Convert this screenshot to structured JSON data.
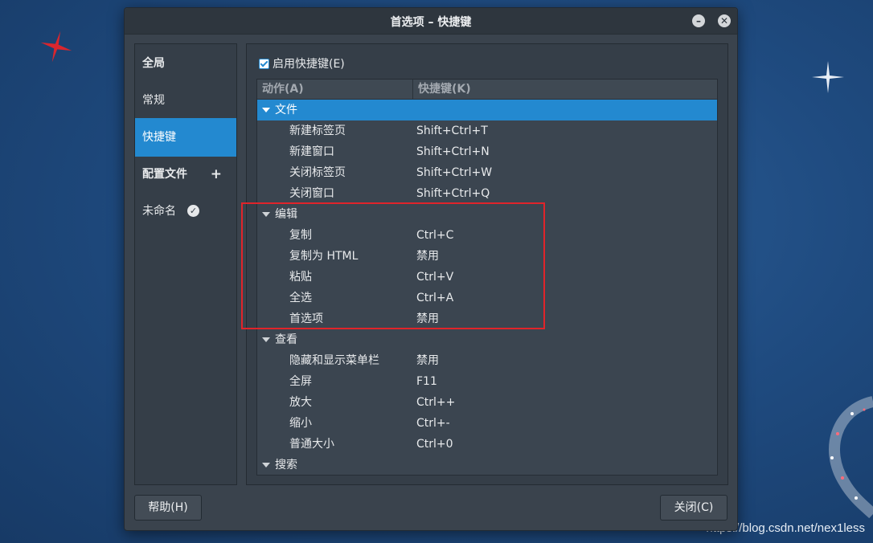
{
  "window": {
    "title": "首选项 – 快捷键",
    "minimize_icon": "minimize-icon",
    "close_icon": "close-icon"
  },
  "sidebar": {
    "items": [
      {
        "label": "全局",
        "type": "header"
      },
      {
        "label": "常规",
        "type": "item"
      },
      {
        "label": "快捷键",
        "type": "item",
        "active": true
      },
      {
        "label": "配置文件",
        "type": "header",
        "icon": "plus-icon",
        "icon_glyph": "+"
      },
      {
        "label": "未命名",
        "type": "item",
        "icon": "check-circle-icon",
        "icon_glyph": "✓"
      }
    ]
  },
  "content": {
    "enable_label": "启用快捷键(E)",
    "enable_checked": true,
    "columns": {
      "action": "动作(A)",
      "shortcut": "快捷键(K)"
    },
    "categories": [
      {
        "label": "文件",
        "selected": true,
        "items": [
          {
            "action": "新建标签页",
            "key": "Shift+Ctrl+T"
          },
          {
            "action": "新建窗口",
            "key": "Shift+Ctrl+N"
          },
          {
            "action": "关闭标签页",
            "key": "Shift+Ctrl+W"
          },
          {
            "action": "关闭窗口",
            "key": "Shift+Ctrl+Q"
          }
        ]
      },
      {
        "label": "编辑",
        "items": [
          {
            "action": "复制",
            "key": "Ctrl+C"
          },
          {
            "action": "复制为 HTML",
            "key": "禁用"
          },
          {
            "action": "粘贴",
            "key": "Ctrl+V"
          },
          {
            "action": "全选",
            "key": "Ctrl+A"
          },
          {
            "action": "首选项",
            "key": "禁用"
          }
        ]
      },
      {
        "label": "查看",
        "items": [
          {
            "action": "隐藏和显示菜单栏",
            "key": "禁用"
          },
          {
            "action": "全屏",
            "key": "F11"
          },
          {
            "action": "放大",
            "key": "Ctrl++"
          },
          {
            "action": "缩小",
            "key": "Ctrl+-"
          },
          {
            "action": "普通大小",
            "key": "Ctrl+0"
          }
        ]
      },
      {
        "label": "搜索",
        "items": []
      }
    ]
  },
  "footer": {
    "help_label": "帮助(H)",
    "close_label": "关闭(C)"
  },
  "watermark": "https://blog.csdn.net/nex1less",
  "colors": {
    "accent": "#2389d0",
    "highlight_box": "#e0242a"
  }
}
